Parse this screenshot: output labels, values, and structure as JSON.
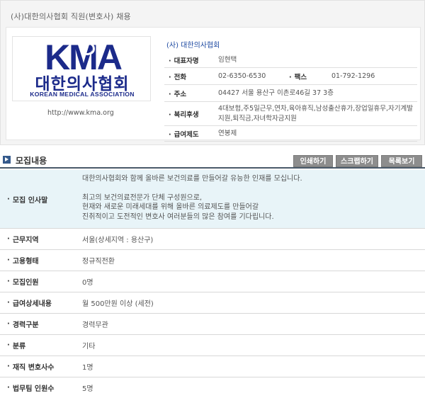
{
  "panel_title": "(사)대한의사협회 직원(변호사) 채용",
  "logo": {
    "mark": "KMA",
    "korean": "대한의사협회",
    "english": "KOREAN MEDICAL ASSOCIATION",
    "url": "http://www.kma.org",
    "brand_color": "#1b2a8a"
  },
  "company": {
    "name": "(사) 대한의사협회",
    "rows": [
      {
        "label": "대표자명",
        "value": "임현택"
      },
      {
        "label": "전화",
        "value": "02-6350-6530",
        "label2": "팩스",
        "value2": "01-792-1296"
      },
      {
        "label": "주소",
        "value": "04427 서울 용산구 이촌로46길 37 3층"
      },
      {
        "label": "복리후생",
        "value": "4대보험,주5일근무,연차,육아휴직,남성출산휴가,장업일휴무,자기계발지원,퇴직금,자녀학자금지원"
      },
      {
        "label": "급여제도",
        "value": "연봉제"
      }
    ]
  },
  "section": {
    "title": "모집내용",
    "buttons": {
      "print": "인쇄하기",
      "scrap": "스크랩하기",
      "list": "목록보기"
    }
  },
  "details": {
    "greeting_label": "모집 인사말",
    "greeting_lines_1": [
      "대한의사협회와 함께 올바른 보건의료를 만들어갈 유능한 인재를 모십니다."
    ],
    "greeting_lines_2": [
      "최고의 보건의료전문가 단체 구성원으로,",
      "현재와 새로운 미래세대를 위해 올바른 의료제도를 만들어갈",
      "진취적이고 도전적인 변호사 여러분들의 많은 참여를 기다립니다."
    ],
    "rows": [
      {
        "label": "근무지역",
        "value": "서울(상세지역 : 용산구)"
      },
      {
        "label": "고용형태",
        "value": "정규직전환"
      },
      {
        "label": "모집인원",
        "value": "0명"
      },
      {
        "label": "급여상세내용",
        "value": "월 500만원 이상 (세전)"
      },
      {
        "label": "경력구분",
        "value": "경력무관"
      },
      {
        "label": "분류",
        "value": "기타"
      },
      {
        "label": "재직 변호사수",
        "value": "1명"
      },
      {
        "label": "법무팀 인원수",
        "value": "5명"
      }
    ]
  }
}
